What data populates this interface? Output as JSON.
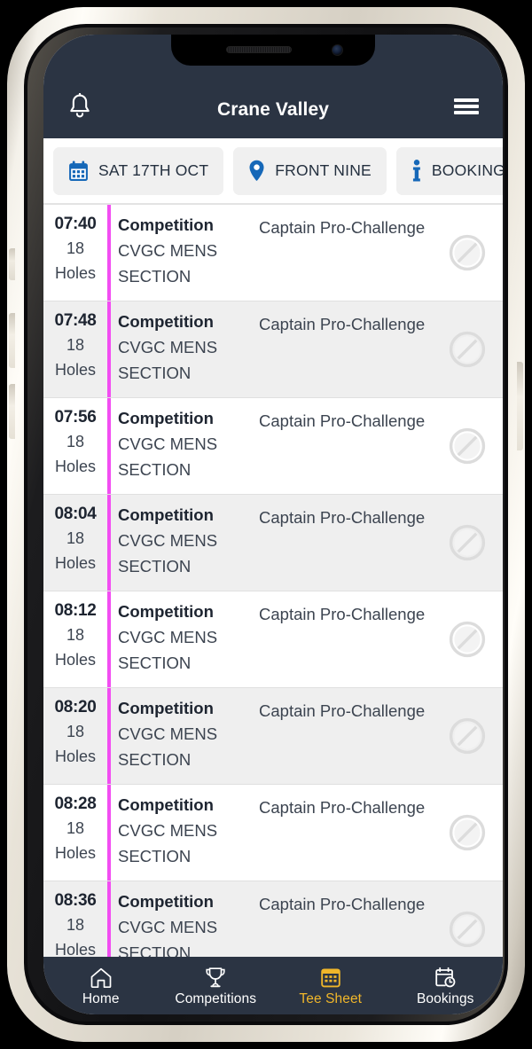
{
  "app": {
    "title": "Crane Valley",
    "header_bg": "#2b3443",
    "accent_blue": "#1668b8",
    "active_gold": "#f0b62a",
    "divider_magenta": "#f24df2"
  },
  "header": {
    "notifications_icon": "bell-icon",
    "menu_icon": "hamburger-menu-icon",
    "title": "Crane Valley"
  },
  "filters": [
    {
      "label": "SAT 17TH OCT",
      "icon": "calendar-icon"
    },
    {
      "label": "FRONT NINE",
      "icon": "map-pin-icon"
    },
    {
      "label": "BOOKING",
      "icon": "info-icon"
    }
  ],
  "tee_sheet": {
    "rows": [
      {
        "time": "07:40",
        "holes_num": "18",
        "holes_word": "Holes",
        "type": "Competition",
        "section": "CVGC MENS SECTION",
        "event": "Captain Pro-Challenge",
        "status_icon": "no-entry-icon"
      },
      {
        "time": "07:48",
        "holes_num": "18",
        "holes_word": "Holes",
        "type": "Competition",
        "section": "CVGC MENS SECTION",
        "event": "Captain Pro-Challenge",
        "status_icon": "no-entry-icon"
      },
      {
        "time": "07:56",
        "holes_num": "18",
        "holes_word": "Holes",
        "type": "Competition",
        "section": "CVGC MENS SECTION",
        "event": "Captain Pro-Challenge",
        "status_icon": "no-entry-icon"
      },
      {
        "time": "08:04",
        "holes_num": "18",
        "holes_word": "Holes",
        "type": "Competition",
        "section": "CVGC MENS SECTION",
        "event": "Captain Pro-Challenge",
        "status_icon": "no-entry-icon"
      },
      {
        "time": "08:12",
        "holes_num": "18",
        "holes_word": "Holes",
        "type": "Competition",
        "section": "CVGC MENS SECTION",
        "event": "Captain Pro-Challenge",
        "status_icon": "no-entry-icon"
      },
      {
        "time": "08:20",
        "holes_num": "18",
        "holes_word": "Holes",
        "type": "Competition",
        "section": "CVGC MENS SECTION",
        "event": "Captain Pro-Challenge",
        "status_icon": "no-entry-icon"
      },
      {
        "time": "08:28",
        "holes_num": "18",
        "holes_word": "Holes",
        "type": "Competition",
        "section": "CVGC MENS SECTION",
        "event": "Captain Pro-Challenge",
        "status_icon": "no-entry-icon"
      },
      {
        "time": "08:36",
        "holes_num": "18",
        "holes_word": "Holes",
        "type": "Competition",
        "section": "CVGC MENS SECTION",
        "event": "Captain Pro-Challenge",
        "status_icon": "no-entry-icon"
      }
    ]
  },
  "bottom_nav": {
    "items": [
      {
        "label": "Home",
        "icon": "home-icon",
        "active": false
      },
      {
        "label": "Competitions",
        "icon": "trophy-icon",
        "active": false
      },
      {
        "label": "Tee Sheet",
        "icon": "calendar-grid-icon",
        "active": true
      },
      {
        "label": "Bookings",
        "icon": "calendar-clock-icon",
        "active": false
      }
    ]
  }
}
